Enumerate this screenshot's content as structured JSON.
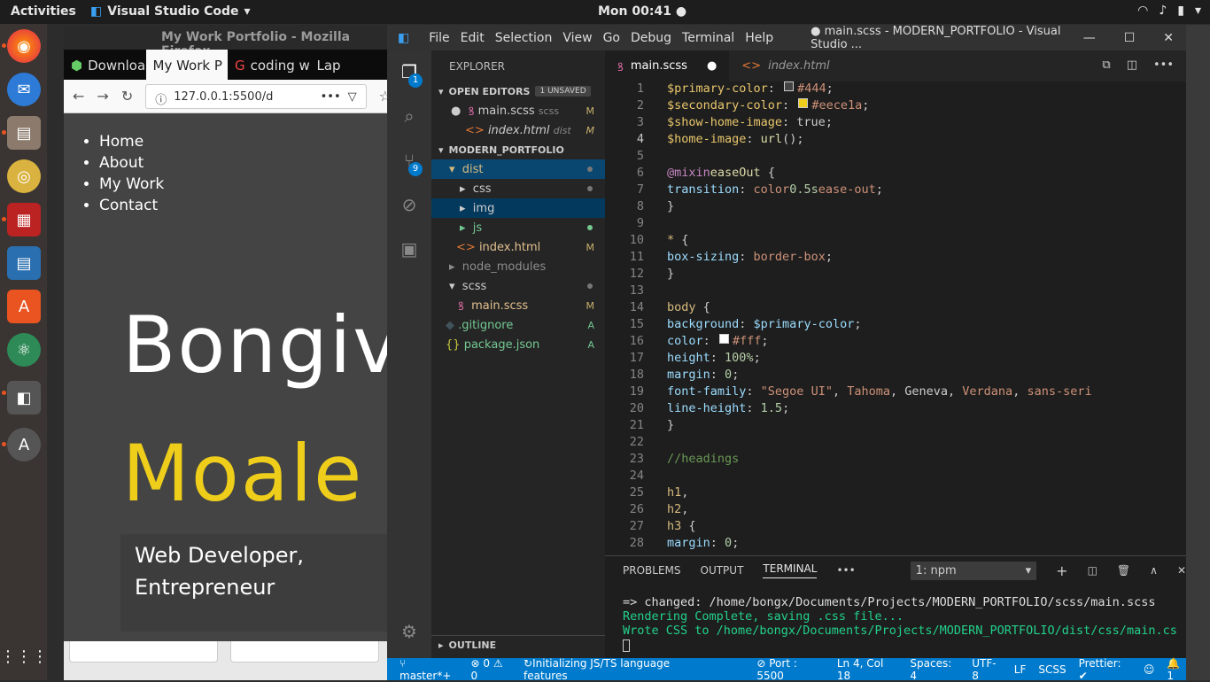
{
  "topbar": {
    "activities": "Activities",
    "app": "Visual Studio Code",
    "clock": "Mon 00:41"
  },
  "firefox": {
    "title": "My Work Portfolio - Mozilla Firefox",
    "tabs": [
      "Download",
      "My Work P",
      "coding wa",
      "Lap"
    ],
    "url": "127.0.0.1:5500/d",
    "nav": [
      "Home",
      "About",
      "My Work",
      "Contact"
    ],
    "big1": "Bongiv",
    "big2": "Moale",
    "sub1": "Web Developer,",
    "sub2": "Entrepreneur"
  },
  "vscode": {
    "menu": [
      "File",
      "Edit",
      "Selection",
      "View",
      "Go",
      "Debug",
      "Terminal",
      "Help"
    ],
    "title": "● main.scss - MODERN_PORTFOLIO - Visual Studio ...",
    "explorer": "EXPLORER",
    "open_editors": "OPEN EDITORS",
    "unsaved": "1 UNSAVED",
    "oe1": "main.scss",
    "oe1_dir": "scss",
    "oe2": "index.html",
    "oe2_dir": "dist",
    "project": "MODERN_PORTFOLIO",
    "tree": {
      "dist": "dist",
      "css": "css",
      "img": "img",
      "js": "js",
      "index": "index.html",
      "node": "node_modules",
      "scss": "scss",
      "main": "main.scss",
      "gitignore": ".gitignore",
      "package": "package.json"
    },
    "m": "M",
    "a": "A",
    "outline": "OUTLINE",
    "tab1": "main.scss",
    "tab2": "index.html",
    "badge1": "1",
    "badge9": "9",
    "panel": {
      "problems": "PROBLEMS",
      "output": "OUTPUT",
      "terminal": "TERMINAL",
      "select": "1: npm",
      "t1": "=> changed: /home/bongx/Documents/Projects/MODERN_PORTFOLIO/scss/main.scss",
      "t2": "Rendering Complete, saving .css file...",
      "t3": "Wrote CSS to /home/bongx/Documents/Projects/MODERN_PORTFOLIO/dist/css/main.cs"
    },
    "status": {
      "branch": "master*+",
      "errors": "0",
      "warnings": "0",
      "init": "Initializing JS/TS language features",
      "port": "Port : 5500",
      "pos": "Ln 4, Col 18",
      "spaces": "Spaces: 4",
      "enc": "UTF-8",
      "eol": "LF",
      "lang": "SCSS",
      "prettier": "Prettier: ✔",
      "bell": "1"
    }
  }
}
